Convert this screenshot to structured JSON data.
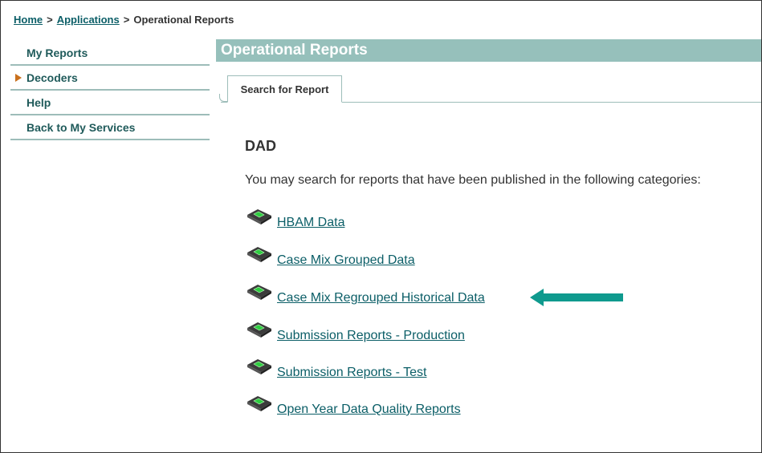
{
  "breadcrumb": {
    "home": "Home",
    "applications": "Applications",
    "separator": ">",
    "current": "Operational Reports"
  },
  "sidebar": {
    "items": [
      {
        "label": "My Reports"
      },
      {
        "label": "Decoders"
      },
      {
        "label": "Help"
      },
      {
        "label": "Back to My Services"
      }
    ]
  },
  "header": {
    "title": "Operational Reports"
  },
  "tabs": [
    {
      "label": "Search for Report",
      "active": true
    }
  ],
  "main": {
    "section_title": "DAD",
    "intro": "You may search for reports that have been published in the following categories:",
    "reports": [
      {
        "label": "HBAM Data",
        "icon": "folder-report-icon"
      },
      {
        "label": "Case Mix Grouped Data",
        "icon": "folder-report-icon"
      },
      {
        "label": "Case Mix Regrouped Historical Data",
        "icon": "folder-report-icon"
      },
      {
        "label": "Submission Reports - Production",
        "icon": "folder-report-icon"
      },
      {
        "label": "Submission Reports - Test",
        "icon": "folder-report-icon"
      },
      {
        "label": "Open Year Data Quality Reports",
        "icon": "folder-report-icon"
      }
    ]
  },
  "colors": {
    "accent": "#96c0bb",
    "link": "#0b5e67",
    "annotation_arrow": "#0f9a8e",
    "decoder_marker": "#c9701c"
  }
}
